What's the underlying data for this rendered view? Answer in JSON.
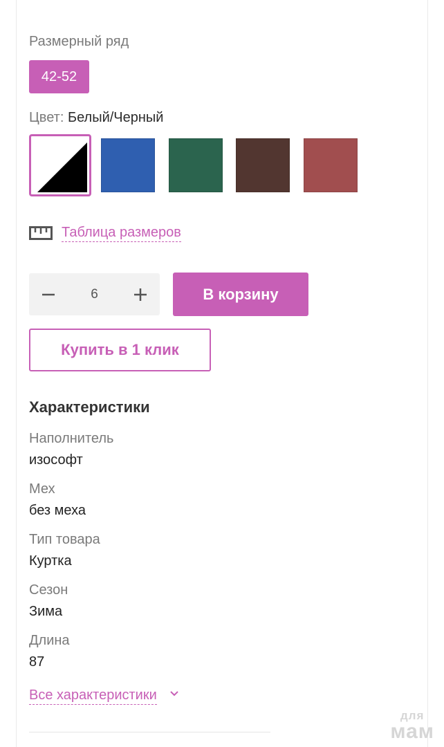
{
  "size_section": {
    "label": "Размерный ряд",
    "selected_size": "42-52"
  },
  "color_section": {
    "label": "Цвет:",
    "selected_value": "Белый/Черный",
    "swatches": [
      {
        "name": "Белый/Черный",
        "color": "#000000",
        "selected": true
      },
      {
        "name": "blue",
        "color": "#2f5fb0"
      },
      {
        "name": "green",
        "color": "#2b644e"
      },
      {
        "name": "brown",
        "color": "#523630"
      },
      {
        "name": "red",
        "color": "#a14e4f"
      }
    ]
  },
  "size_table_link": "Таблица размеров",
  "purchase": {
    "quantity": "6",
    "add_to_cart": "В корзину",
    "buy_one_click": "Купить в 1 клик"
  },
  "characteristics": {
    "title": "Характеристики",
    "items": [
      {
        "name": "Наполнитель",
        "value": "изософт"
      },
      {
        "name": "Мех",
        "value": "без меха"
      },
      {
        "name": "Тип товара",
        "value": "Куртка"
      },
      {
        "name": "Сезон",
        "value": "Зима"
      },
      {
        "name": "Длина",
        "value": "87"
      }
    ],
    "all_link": "Все характеристики"
  },
  "watermark": {
    "line1": "для",
    "line2": "мам"
  },
  "colors": {
    "accent": "#c75fb6"
  }
}
